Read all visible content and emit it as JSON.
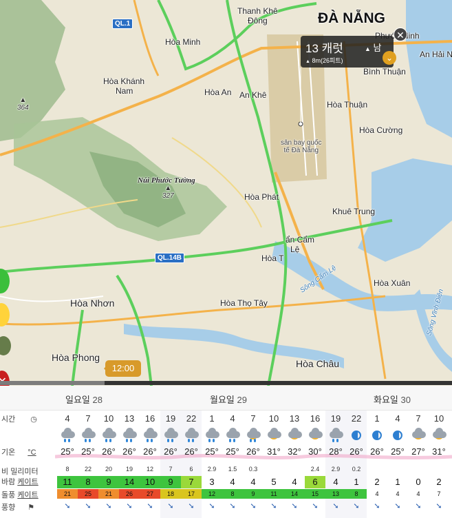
{
  "map": {
    "city_title": "ĐÀ NẴNG",
    "labels": {
      "thanh_khe": "Thanh Khê",
      "dong": "Đông",
      "hoa_minh": "Hòa Minh",
      "phuoc_ninh": "Phước Ninh",
      "an_hai_n": "An Hải N",
      "binh_thuan": "Bình Thuận",
      "hoa_khanh_nam_1": "Hòa Khánh",
      "hoa_khanh_nam_2": "Nam",
      "hoa_an": "Hòa An",
      "an_khe": "An Khê",
      "hoa_thuan": "Hòa Thuận",
      "hoa_cuong": "Hòa Cường",
      "airport_1": "sân bay quốc",
      "airport_2": "tế Đà Nẵng",
      "nui_phuoc_tuong": "Núi Phước Tường",
      "hoa_phat": "Hòa Phát",
      "khue_trung": "Khuê Trung",
      "can_cam_le_1": "ẩn Cẩm",
      "can_cam_le_2": "Lệ",
      "hoa_t": "Hòa T",
      "hoa_nhon": "Hòa Nhơn",
      "hoa_tho_tay": "Hòa Thọ Tây",
      "hoa_xuan": "Hòa Xuân",
      "hoa_phong": "Hòa Phong",
      "hoa_chau": "Hòa Châu",
      "song_cam_le": "Sông Cẩm Lệ",
      "song_vinh_dien": "Sông Vĩnh Điện"
    },
    "peaks": {
      "peak_364": "364",
      "peak_327": "327"
    },
    "shields": {
      "ql1": "QL.1",
      "ql14b": "QL.14B"
    }
  },
  "popup": {
    "speed": "13 캐럿",
    "direction_arrow": "▲",
    "direction": "남",
    "elevation_arrow": "▲",
    "elevation": "8m(26피트)",
    "close_icon": "✕",
    "expand_icon": "⌄"
  },
  "timeline": {
    "current_time": "12:00"
  },
  "forecast": {
    "days": [
      {
        "name": "일요일",
        "date": "28"
      },
      {
        "name": "월요일",
        "date": "29"
      },
      {
        "name": "화요일",
        "date": "30"
      }
    ],
    "row_labels": {
      "time": "시간",
      "temp": "기온",
      "temp_unit": "°C",
      "rain": "비",
      "rain_unit": "밀리미터",
      "wind": "바람",
      "wind_unit": "케이트",
      "gust": "돌풍",
      "gust_unit": "케이트",
      "direction": "풍향"
    },
    "hours": [
      "4",
      "7",
      "10",
      "13",
      "16",
      "19",
      "22",
      "1",
      "4",
      "7",
      "10",
      "13",
      "16",
      "19",
      "22",
      "1",
      "4",
      "7",
      "10"
    ],
    "icons": [
      "rain",
      "rain",
      "rain",
      "rain",
      "rain",
      "rain",
      "rain",
      "rain",
      "rain",
      "sun-rain",
      "cloud-sun",
      "cloud-sun",
      "cloud-sun",
      "rain",
      "moon",
      "moon",
      "moon",
      "sun-cloud",
      "sun-cloud"
    ],
    "temps": [
      "25°",
      "25°",
      "26°",
      "26°",
      "26°",
      "26°",
      "26°",
      "25°",
      "25°",
      "26°",
      "31°",
      "32°",
      "30°",
      "28°",
      "26°",
      "26°",
      "25°",
      "27°",
      "31°"
    ],
    "rain": [
      "8",
      "22",
      "20",
      "19",
      "12",
      "7",
      "6",
      "2.9",
      "1.5",
      "0.3",
      "",
      "",
      "2.4",
      "2.9",
      "0.2",
      "",
      "",
      "",
      ""
    ],
    "wind": [
      "11",
      "8",
      "9",
      "14",
      "10",
      "9",
      "7",
      "3",
      "4",
      "4",
      "5",
      "4",
      "6",
      "4",
      "1",
      "2",
      "1",
      "0",
      "2"
    ],
    "gust": [
      "21",
      "25",
      "21",
      "26",
      "27",
      "18",
      "17",
      "12",
      "8",
      "9",
      "11",
      "14",
      "15",
      "13",
      "8",
      "4",
      "4",
      "4",
      "7"
    ],
    "dir_arrow": "➘",
    "colors": {
      "wind_strong": "#3ec43e",
      "wind_med": "#9ad93a",
      "gust_red": "#e84a2a",
      "gust_orange": "#ef8d2e",
      "gust_yellow": "#d9c51e",
      "gust_green": "#3ec43e",
      "accent": "#d89a2a"
    }
  }
}
